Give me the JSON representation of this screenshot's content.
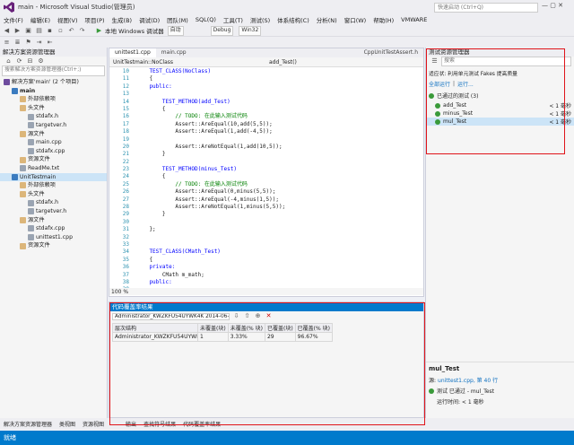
{
  "window": {
    "title": "main - Microsoft Visual Studio(管理员)",
    "quick_launch_placeholder": "快速启动 (Ctrl+Q)",
    "controls": "— ▢ ✕"
  },
  "menu": [
    "文件(F)",
    "编辑(E)",
    "视图(V)",
    "项目(P)",
    "生成(B)",
    "调试(D)",
    "团队(M)",
    "SQL(Q)",
    "工具(T)",
    "测试(S)",
    "体系结构(C)",
    "分析(N)",
    "窗口(W)",
    "帮助(H)",
    "VMWARE"
  ],
  "toolbar": {
    "debugger": "本地 Windows 调试器",
    "mode": "自动",
    "config": "Debug",
    "platform": "Win32"
  },
  "solution_explorer": {
    "title": "解决方案资源管理器",
    "search_placeholder": "搜索解决方案资源管理器(Ctrl+;)",
    "items": [
      {
        "label": "解决方案'main' (2 个项目)",
        "indent": 0,
        "icon": "solution"
      },
      {
        "label": "main",
        "indent": 1,
        "icon": "project",
        "bold": true
      },
      {
        "label": "外部依赖项",
        "indent": 2,
        "icon": "folder"
      },
      {
        "label": "头文件",
        "indent": 2,
        "icon": "folder"
      },
      {
        "label": "stdafx.h",
        "indent": 3,
        "icon": "file"
      },
      {
        "label": "targetver.h",
        "indent": 3,
        "icon": "file"
      },
      {
        "label": "源文件",
        "indent": 2,
        "icon": "folder"
      },
      {
        "label": "main.cpp",
        "indent": 3,
        "icon": "file"
      },
      {
        "label": "stdafx.cpp",
        "indent": 3,
        "icon": "file"
      },
      {
        "label": "资源文件",
        "indent": 2,
        "icon": "folder"
      },
      {
        "label": "ReadMe.txt",
        "indent": 2,
        "icon": "file"
      },
      {
        "label": "UnitTestmain",
        "indent": 1,
        "icon": "project",
        "selected": true
      },
      {
        "label": "外部依赖项",
        "indent": 2,
        "icon": "folder"
      },
      {
        "label": "头文件",
        "indent": 2,
        "icon": "folder"
      },
      {
        "label": "stdafx.h",
        "indent": 3,
        "icon": "file"
      },
      {
        "label": "targetver.h",
        "indent": 3,
        "icon": "file"
      },
      {
        "label": "源文件",
        "indent": 2,
        "icon": "folder"
      },
      {
        "label": "stdafx.cpp",
        "indent": 3,
        "icon": "file"
      },
      {
        "label": "unittest1.cpp",
        "indent": 3,
        "icon": "file"
      },
      {
        "label": "资源文件",
        "indent": 2,
        "icon": "folder"
      }
    ]
  },
  "editor": {
    "tabs": [
      "unittest1.cpp",
      "main.cpp",
      "CppUnitTestAssert.h"
    ],
    "nav_left": "UnitTestmain::NoClass",
    "nav_right": "add_Test()",
    "zoom": "100 %",
    "lines": [
      {
        "n": "10",
        "code": "    TEST_CLASS(NoClass)"
      },
      {
        "n": "11",
        "code": "    {"
      },
      {
        "n": "12",
        "code": "    public:"
      },
      {
        "n": "13",
        "code": ""
      },
      {
        "n": "14",
        "code": "        TEST_METHOD(add_Test)"
      },
      {
        "n": "15",
        "code": "        {"
      },
      {
        "n": "16",
        "code": "            // TODO: 在此输入测试代码"
      },
      {
        "n": "17",
        "code": "            Assert::AreEqual(10,add(5,5));"
      },
      {
        "n": "18",
        "code": "            Assert::AreEqual(1,add(-4,5));"
      },
      {
        "n": "19",
        "code": ""
      },
      {
        "n": "20",
        "code": "            Assert::AreNotEqual(1,add(10,5));"
      },
      {
        "n": "21",
        "code": "        }"
      },
      {
        "n": "22",
        "code": ""
      },
      {
        "n": "23",
        "code": "        TEST_METHOD(minus_Test)"
      },
      {
        "n": "24",
        "code": "        {"
      },
      {
        "n": "25",
        "code": "            // TODO: 在此输入测试代码"
      },
      {
        "n": "26",
        "code": "            Assert::AreEqual(0,minus(5,5));"
      },
      {
        "n": "27",
        "code": "            Assert::AreEqual(-4,minus(1,5));"
      },
      {
        "n": "28",
        "code": "            Assert::AreNotEqual(1,minus(5,5));"
      },
      {
        "n": "29",
        "code": "        }"
      },
      {
        "n": "30",
        "code": ""
      },
      {
        "n": "31",
        "code": "    };"
      },
      {
        "n": "32",
        "code": ""
      },
      {
        "n": "33",
        "code": ""
      },
      {
        "n": "34",
        "code": "    TEST_CLASS(CMath_Test)"
      },
      {
        "n": "35",
        "code": "    {"
      },
      {
        "n": "36",
        "code": "    private:"
      },
      {
        "n": "37",
        "code": "        CMath m_math;"
      },
      {
        "n": "38",
        "code": "    public:"
      },
      {
        "n": "39",
        "code": ""
      },
      {
        "n": "40",
        "code": "        TEST_METHOD(mul_Test)"
      }
    ]
  },
  "coverage": {
    "title": "代码覆盖率结果",
    "session": "Administrator_KWZKFU54UYWK4K 2014-06-",
    "headers": [
      "层次结构",
      "未覆盖(块)",
      "未覆盖(% 块)",
      "已覆盖(块)",
      "已覆盖(% 块)"
    ],
    "rows": [
      [
        "Administrator_KWZKFU54UYWK4...",
        "1",
        "3.33%",
        "29",
        "96.67%"
      ]
    ]
  },
  "test_explorer": {
    "title": "测试资源管理器",
    "search_placeholder": "搜索",
    "info": "适应状: 利用单元测试 Fakes 提高质量",
    "run_all": "全部运行",
    "run": "运行...",
    "group_title": "已通过的测试 (3)",
    "tests": [
      {
        "name": "add_Test",
        "time": "< 1 毫秒"
      },
      {
        "name": "minus_Test",
        "time": "< 1 毫秒"
      },
      {
        "name": "mul_Test",
        "time": "< 1 毫秒"
      }
    ],
    "detail_title": "mul_Test",
    "detail_source_label": "源:",
    "detail_source": "unittest1.cpp, 第 40 行",
    "detail_status": "测试 已通过 - mul_Test",
    "detail_time": "运行时间: < 1 毫秒"
  },
  "bottom_tabs": [
    "解决方案资源管理器",
    "类视图",
    "资源视图",
    "输出",
    "查找符号结果",
    "代码覆盖率结果"
  ],
  "status": "就绪",
  "colors": {
    "accent": "#007acc",
    "highlight": "#e0141a",
    "pass": "#3a9a3a"
  }
}
